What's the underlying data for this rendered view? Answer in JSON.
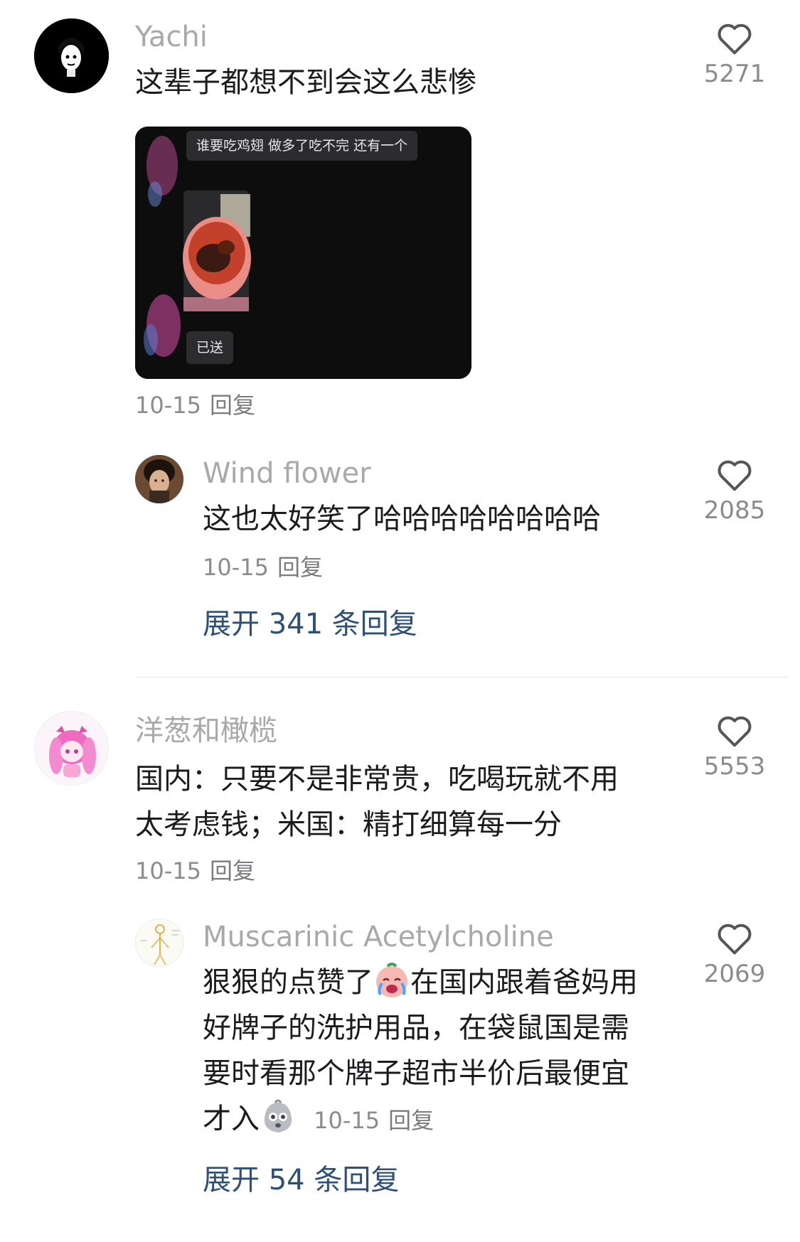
{
  "comments": [
    {
      "username": "Yachi",
      "text": "这辈子都想不到会这么悲惨",
      "likes": "5271",
      "date": "10-15",
      "reply_label": "回复",
      "image": {
        "top_caption": "谁要吃鸡翅 做多了吃不完 还有一个",
        "bottom_caption": "已送"
      },
      "reply": {
        "username": "Wind flower",
        "text": "这也太好笑了哈哈哈哈哈哈哈哈",
        "likes": "2085",
        "date": "10-15",
        "reply_label": "回复"
      },
      "expand_label": "展开 341 条回复"
    },
    {
      "username": "洋葱和橄榄",
      "text_line1": "国内：只要不是非常贵，吃喝玩就不用",
      "text_line2": "太考虑钱；米国：精打细算每一分",
      "likes": "5553",
      "date": "10-15",
      "reply_label": "回复",
      "reply": {
        "username": "Muscarinic Acetylcholine",
        "text_part1": "狠狠的点赞了",
        "text_part2": "在国内跟着爸妈用",
        "text_line2": "好牌子的洗护用品，在袋鼠国是需",
        "text_line3": "要时看那个牌子超市半价后最便宜",
        "text_line4": "才入",
        "likes": "2069",
        "date": "10-15",
        "reply_label": "回复"
      },
      "expand_label": "展开 54 条回复"
    }
  ],
  "colors": {
    "username": "#a8a8ad",
    "text": "#1b1b1f",
    "meta": "#8a8a90",
    "expand": "#2d4f78",
    "divider": "#e6e6e8"
  },
  "icons": [
    "heart-outline-icon",
    "crying-emoji-icon",
    "dizzy-emoji-icon"
  ]
}
